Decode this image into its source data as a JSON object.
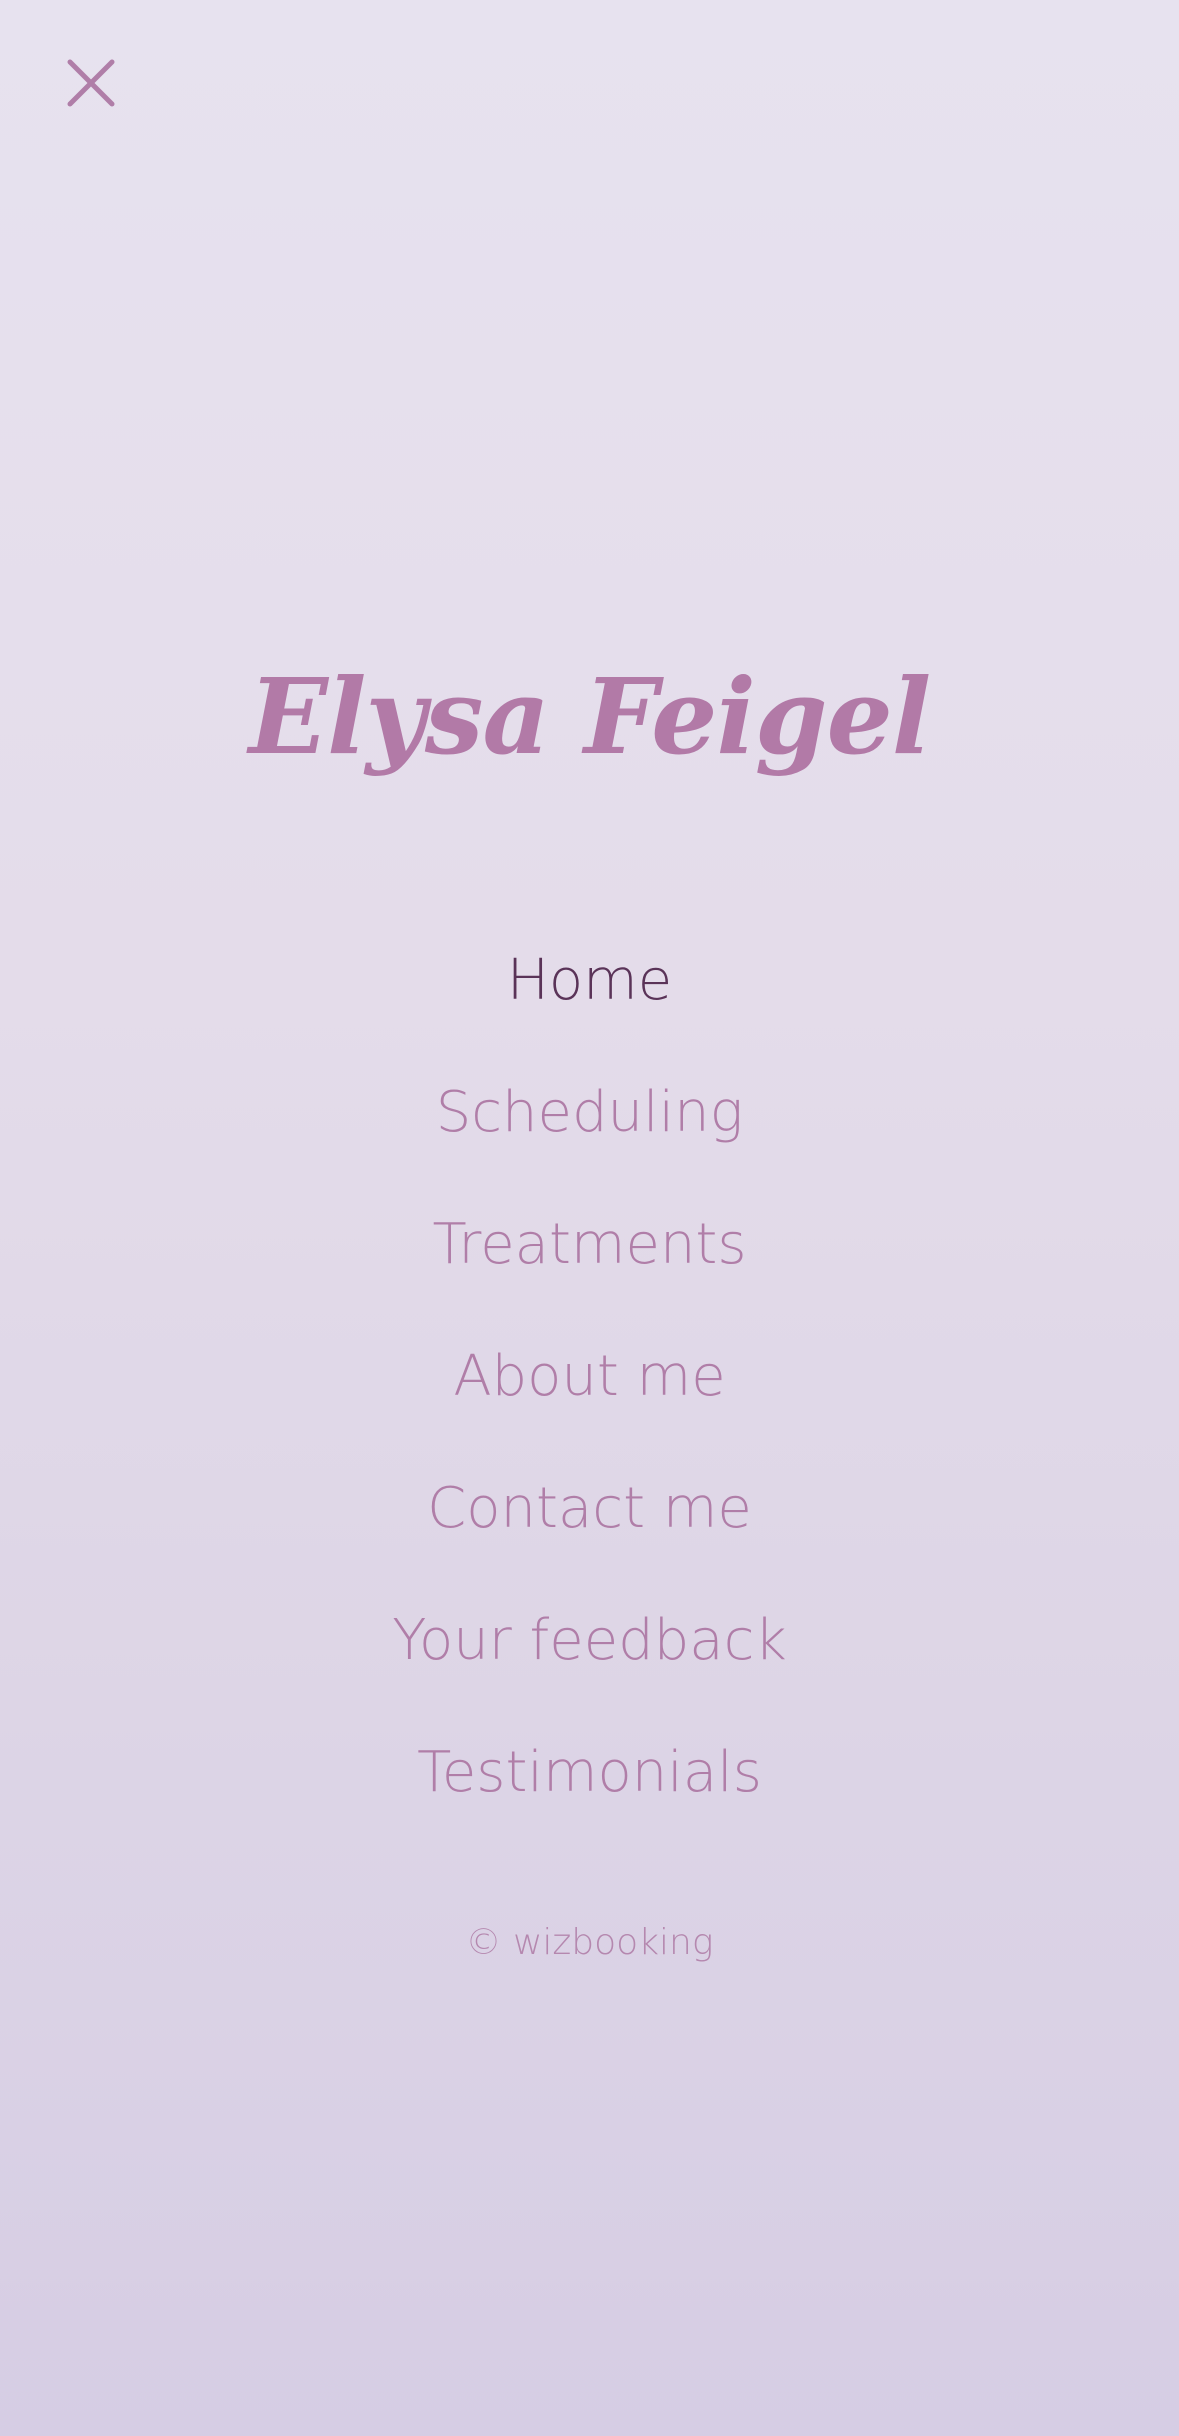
{
  "header": {
    "close_icon": "close-icon"
  },
  "brand": {
    "name": "Elysa Feigel"
  },
  "menu": {
    "items": [
      {
        "label": "Home",
        "active": true
      },
      {
        "label": "Scheduling",
        "active": false
      },
      {
        "label": "Treatments",
        "active": false
      },
      {
        "label": "About me",
        "active": false
      },
      {
        "label": "Contact me",
        "active": false
      },
      {
        "label": "Your feedback",
        "active": false
      },
      {
        "label": "Testimonials",
        "active": false
      }
    ]
  },
  "footer": {
    "copyright": "© wizbooking"
  },
  "colors": {
    "accent": "#b07ea8",
    "active": "#5a3358",
    "background_top": "#e7e2ef",
    "background_bottom": "#d6cde4"
  }
}
